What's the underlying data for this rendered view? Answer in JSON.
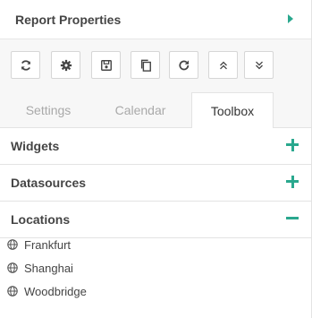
{
  "header": {
    "title": "Report Properties"
  },
  "toolbar": {
    "buttons": [
      {
        "name": "refresh-button",
        "icon": "refresh-icon"
      },
      {
        "name": "settings-button",
        "icon": "gear-icon"
      },
      {
        "name": "save-button",
        "icon": "save-icon"
      },
      {
        "name": "copy-button",
        "icon": "copy-icon"
      },
      {
        "name": "redo-button",
        "icon": "redo-icon"
      },
      {
        "name": "expand-all-button",
        "icon": "chevrons-up-icon"
      },
      {
        "name": "collapse-all-button",
        "icon": "chevrons-down-icon"
      }
    ]
  },
  "tabs": [
    {
      "label": "Settings",
      "active": false
    },
    {
      "label": "Calendar",
      "active": false
    },
    {
      "label": "Toolbox",
      "active": true
    }
  ],
  "sections": [
    {
      "label": "Widgets",
      "state": "collapsed"
    },
    {
      "label": "Datasources",
      "state": "collapsed"
    },
    {
      "label": "Locations",
      "state": "expanded"
    }
  ],
  "locations": [
    {
      "name": "Frankfurt",
      "icon": "globe-icon"
    },
    {
      "name": "Shanghai",
      "icon": "globe-icon"
    },
    {
      "name": "Woodbridge",
      "icon": "globe-icon"
    }
  ],
  "colors": {
    "accent": "#2aa88e",
    "text": "#454545",
    "muted": "#a9a9a9"
  }
}
